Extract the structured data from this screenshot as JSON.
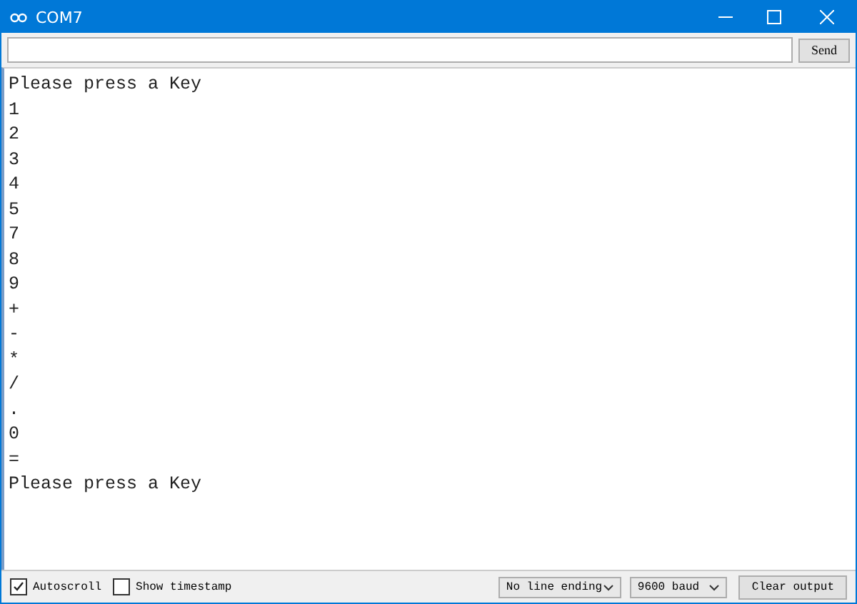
{
  "window": {
    "title": "COM7"
  },
  "send_bar": {
    "button": "Send"
  },
  "output_lines": [
    "Please press a Key",
    "1",
    "2",
    "3",
    "4",
    "5",
    "7",
    "8",
    "9",
    "+",
    "-",
    "*",
    "/",
    ".",
    "0",
    "=",
    "Please press a Key"
  ],
  "status_bar": {
    "autoscroll": {
      "label": "Autoscroll",
      "checked": true
    },
    "timestamp": {
      "label": "Show timestamp",
      "checked": false
    },
    "line_ending": "No line ending",
    "baud": "9600 baud",
    "clear_button": "Clear output"
  }
}
